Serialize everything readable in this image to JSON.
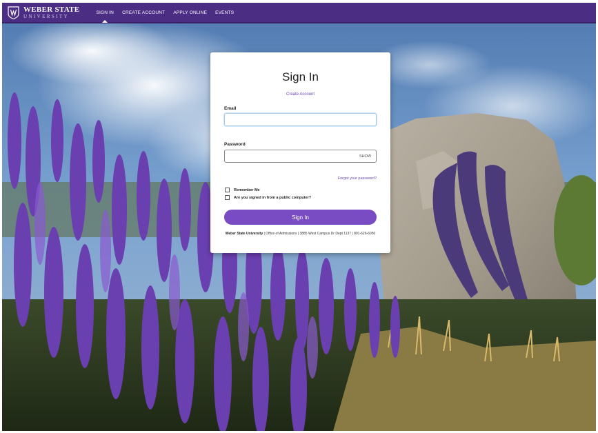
{
  "brand": {
    "name": "WEBER STATE",
    "sub": "UNIVERSITY"
  },
  "nav": [
    {
      "label": "SIGN IN",
      "active": true
    },
    {
      "label": "CREATE ACCOUNT",
      "active": false
    },
    {
      "label": "APPLY ONLINE",
      "active": false
    },
    {
      "label": "EVENTS",
      "active": false
    }
  ],
  "signin": {
    "title": "Sign In",
    "create_account": "Create Account",
    "email_label": "Email",
    "email_value": "",
    "password_label": "Password",
    "password_value": "",
    "show_label": "SHOW",
    "forgot_label": "Forgot your password?",
    "remember_label": "Remember Me",
    "public_label": "Are you signed in from a public computer?",
    "button_label": "Sign In",
    "footer_org": "Weber State University",
    "footer_text": " | Office of Admissions | 3885 West Campus Dr Dept 1137 | 801-626-6050"
  },
  "colors": {
    "brand_purple": "#4b2e83",
    "button_purple": "#7a4cc4",
    "link_purple": "#6a44b8"
  }
}
